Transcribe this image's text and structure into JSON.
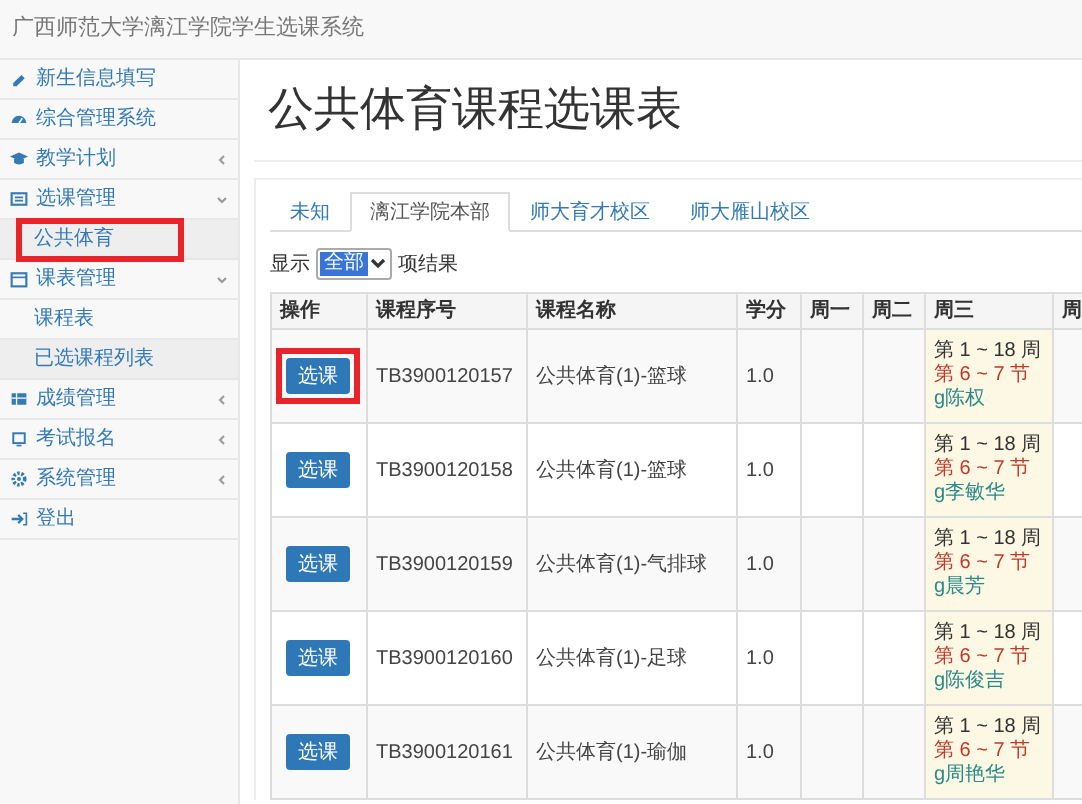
{
  "app_title": "广西师范大学漓江学院学生选课系统",
  "sidebar": {
    "items": [
      {
        "label": "新生信息填写"
      },
      {
        "label": "综合管理系统"
      },
      {
        "label": "教学计划",
        "expanded": false
      },
      {
        "label": "选课管理",
        "expanded": true,
        "children": [
          {
            "label": "公共体育",
            "selected": true,
            "highlighted": true
          }
        ]
      },
      {
        "label": "课表管理",
        "expanded": true,
        "children": [
          {
            "label": "课程表",
            "selected": false,
            "highlighted": false
          },
          {
            "label": "已选课程列表",
            "selected": true,
            "highlighted": false
          }
        ]
      },
      {
        "label": "成绩管理",
        "expanded": false
      },
      {
        "label": "考试报名",
        "expanded": false
      },
      {
        "label": "系统管理",
        "expanded": false
      },
      {
        "label": "登出"
      }
    ]
  },
  "page_title": "公共体育课程选课表",
  "tabs": [
    {
      "label": "未知",
      "selected": false
    },
    {
      "label": "漓江学院本部",
      "selected": true
    },
    {
      "label": "师大育才校区",
      "selected": false
    },
    {
      "label": "师大雁山校区",
      "selected": false
    }
  ],
  "show_filter": {
    "prefix": "显示",
    "value": "全部",
    "suffix": "项结果"
  },
  "table": {
    "columns": [
      "操作",
      "课程序号",
      "课程名称",
      "学分",
      "周一",
      "周二",
      "周三",
      "周"
    ],
    "rows": [
      {
        "button": "选课",
        "highlighted": true,
        "code": "TB3900120157",
        "name": "公共体育(1)-篮球",
        "credit": "1.0",
        "weeks": "第 1 ~ 18 周",
        "periods": "第 6 ~ 7 节",
        "teacher": "g陈权"
      },
      {
        "button": "选课",
        "highlighted": false,
        "code": "TB3900120158",
        "name": "公共体育(1)-篮球",
        "credit": "1.0",
        "weeks": "第 1 ~ 18 周",
        "periods": "第 6 ~ 7 节",
        "teacher": "g李敏华"
      },
      {
        "button": "选课",
        "highlighted": false,
        "code": "TB3900120159",
        "name": "公共体育(1)-气排球",
        "credit": "1.0",
        "weeks": "第 1 ~ 18 周",
        "periods": "第 6 ~ 7 节",
        "teacher": "g晨芳"
      },
      {
        "button": "选课",
        "highlighted": false,
        "code": "TB3900120160",
        "name": "公共体育(1)-足球",
        "credit": "1.0",
        "weeks": "第 1 ~ 18 周",
        "periods": "第 6 ~ 7 节",
        "teacher": "g陈俊吉"
      },
      {
        "button": "选课",
        "highlighted": false,
        "code": "TB3900120161",
        "name": "公共体育(1)-瑜伽",
        "credit": "1.0",
        "weeks": "第 1 ~ 18 周",
        "periods": "第 6 ~ 7 节",
        "teacher": "g周艳华"
      }
    ]
  }
}
